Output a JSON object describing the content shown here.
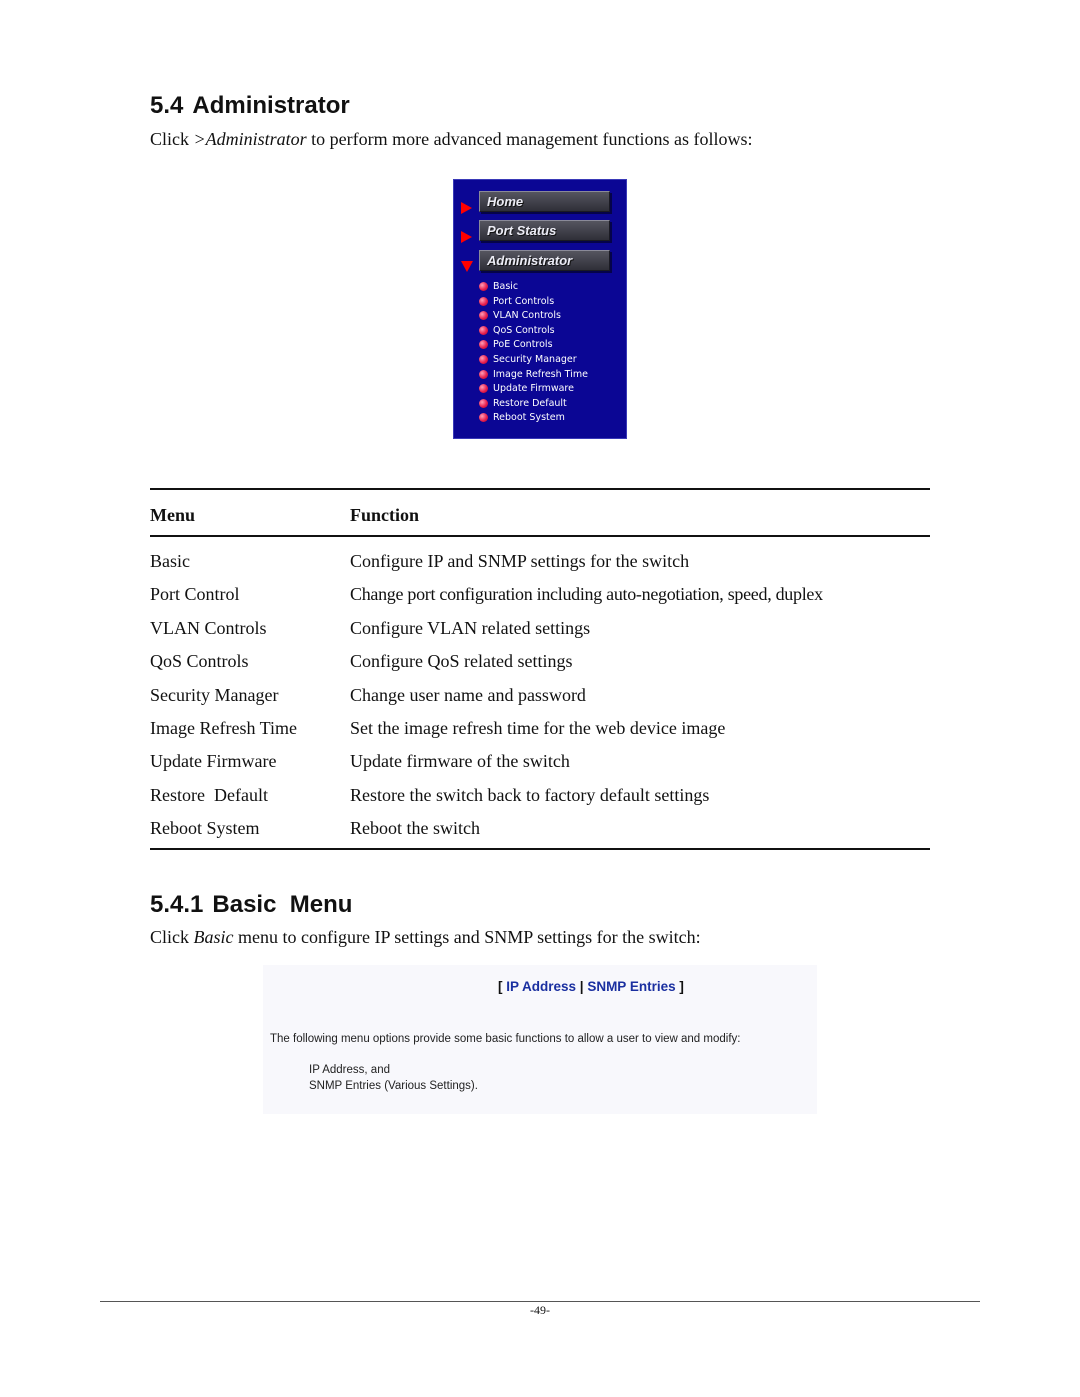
{
  "section": {
    "number": "5.4",
    "title": "Administrator",
    "intro_prefix": "Click ",
    "intro_em": ">Administrator",
    "intro_suffix": " to perform more advanced management functions as follows:"
  },
  "nav_panel": {
    "colors": {
      "background": "#0b0694",
      "arrow": "#ff0000",
      "bullet": "#e8204f"
    },
    "buttons": [
      {
        "label": "Home",
        "arrow": "right-arrow-icon"
      },
      {
        "label": "Port Status",
        "arrow": "right-arrow-icon"
      },
      {
        "label": "Administrator",
        "arrow": "down-arrow-icon"
      }
    ],
    "submenu": [
      "Basic",
      "Port Controls",
      "VLAN Controls",
      "QoS Controls",
      "PoE Controls",
      "Security Manager",
      "Image Refresh Time",
      "Update Firmware",
      "Restore Default",
      "Reboot System"
    ]
  },
  "table": {
    "headers": {
      "menu": "Menu",
      "function": "Function"
    },
    "rows": [
      {
        "menu": "Basic",
        "function": "Configure IP and SNMP settings for the switch"
      },
      {
        "menu": "Port Control",
        "function": "Change port configuration including auto-negotiation, speed, duplex"
      },
      {
        "menu": "VLAN Controls",
        "function": "Configure VLAN related settings"
      },
      {
        "menu": "QoS Controls",
        "function": "Configure QoS related settings"
      },
      {
        "menu": "Security Manager",
        "function": "Change user name and password"
      },
      {
        "menu": "Image Refresh Time",
        "function": "Set the image refresh time for the web device image"
      },
      {
        "menu": "Update Firmware",
        "function": "Update firmware of the switch"
      },
      {
        "menu": "Restore  Default",
        "function": "Restore the switch back to factory default settings"
      },
      {
        "menu": "Reboot System",
        "function": "Reboot the switch"
      }
    ]
  },
  "subsection": {
    "number": "5.4.1",
    "title": "Basic  Menu",
    "intro_prefix": "Click ",
    "intro_em": "Basic",
    "intro_suffix": " menu to configure IP settings and SNMP settings for the switch:"
  },
  "basic_screen": {
    "bracket_open": "[ ",
    "link_ip": "IP Address",
    "separator": " | ",
    "link_snmp": "SNMP Entries",
    "bracket_close": " ]",
    "description": "The following menu options provide some basic functions to allow a user to view and modify:",
    "option_1": "IP Address, and",
    "option_2": "SNMP Entries (Various Settings).",
    "link_color": "#1a2fa0"
  },
  "footer": {
    "page_number": "-49-"
  }
}
